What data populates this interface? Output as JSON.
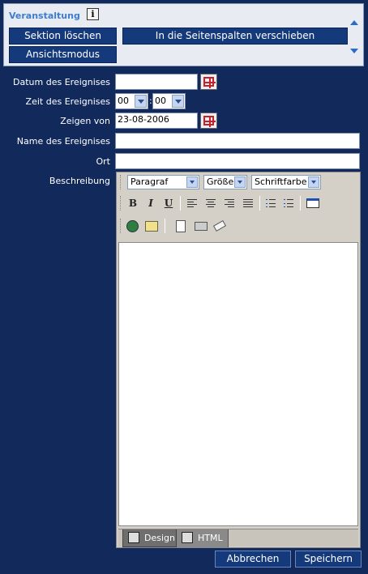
{
  "section": {
    "title": "Veranstaltung",
    "delete_label": "Sektion löschen",
    "move_label": "In die Seitenspalten verschieben",
    "view_label": "Ansichtsmodus"
  },
  "form": {
    "date_label": "Datum des Ereignises",
    "date_value": "",
    "time_label": "Zeit des Ereignises",
    "time_hour": "00",
    "time_minute": "00",
    "time_sep": ":",
    "show_from_label": "Zeigen von",
    "show_from_value": "23-08-2006",
    "name_label": "Name des Ereignises",
    "name_value": "",
    "place_label": "Ort",
    "place_value": "",
    "description_label": "Beschreibung"
  },
  "editor": {
    "format_select": "Paragraf",
    "size_select": "Größe",
    "color_select": "Schriftfarbe",
    "bold": "B",
    "italic": "I",
    "underline": "U",
    "tab_design": "Design",
    "tab_html": "HTML"
  },
  "actions": {
    "cancel_label": "Abbrechen",
    "save_label": "Speichern"
  }
}
